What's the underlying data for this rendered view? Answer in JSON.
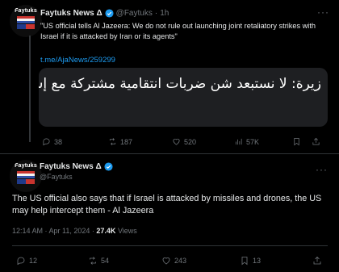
{
  "tweet1": {
    "avatar_text": "Faytuks",
    "name": "Faytuks News Δ",
    "handle": "@Faytuks",
    "separator": "·",
    "time": "1h",
    "text": "\"US official tells Al Jazeera: We do not rule out launching joint retaliatory strikes with Israel if it is attacked by Iran or its agents\"",
    "link": "t.me/AjaNews/259299",
    "card_text": "زيرة: لا نستبعد شن ضربات انتقامية مشتركة مع إسرائيل",
    "replies": "38",
    "reposts": "187",
    "likes": "520",
    "views": "57K"
  },
  "tweet2": {
    "avatar_text": "Faytuks",
    "name": "Faytuks News Δ",
    "handle": "@Faytuks",
    "text": "The US official also says that if Israel is attacked by missiles and drones, the US may help intercept them - Al Jazeera",
    "timestamp": "12:14 AM · Apr 11, 2024 · ",
    "views_count": "27.4K",
    "views_label": " Views",
    "replies": "12",
    "reposts": "54",
    "likes": "243",
    "bookmarks": "13"
  },
  "colors": {
    "accent": "#1d9bf0",
    "muted": "#71767b",
    "text": "#e7e9ea",
    "background": "#000000",
    "card": "#1e1f22"
  }
}
